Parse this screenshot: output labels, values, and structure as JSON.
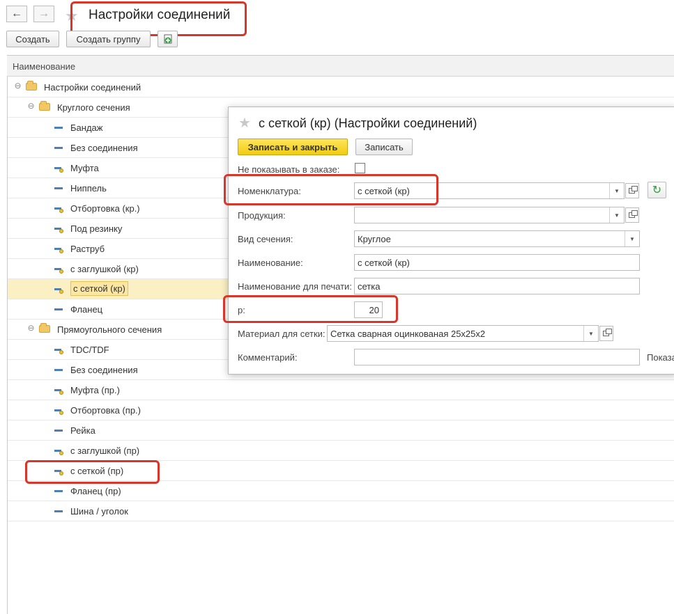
{
  "window": {
    "title": "Настройки соединений",
    "nav": {
      "back_icon": "←",
      "forward_icon": "→",
      "star_icon": "★"
    }
  },
  "toolbar": {
    "create_label": "Создать",
    "create_group_label": "Создать группу",
    "copy_icon": "add-copy-icon"
  },
  "list": {
    "column_header": "Наименование",
    "rows": [
      {
        "label": "Настройки соединений",
        "type": "group",
        "level": 0
      },
      {
        "label": "Круглого сечения",
        "type": "group",
        "level": 1
      },
      {
        "label": "Бандаж",
        "type": "item",
        "level": 2
      },
      {
        "label": "Без соединения",
        "type": "item",
        "level": 2
      },
      {
        "label": "Муфта",
        "type": "item-marked",
        "level": 2
      },
      {
        "label": "Ниппель",
        "type": "item",
        "level": 2
      },
      {
        "label": "Отбортовка (кр.)",
        "type": "item-marked",
        "level": 2
      },
      {
        "label": "Под резинку",
        "type": "item-marked",
        "level": 2
      },
      {
        "label": "Раструб",
        "type": "item-marked",
        "level": 2
      },
      {
        "label": "с заглушкой (кр)",
        "type": "item-marked",
        "level": 2
      },
      {
        "label": "с сеткой (кр)",
        "type": "item-marked",
        "level": 2,
        "selected": true
      },
      {
        "label": "Фланец",
        "type": "item",
        "level": 2
      },
      {
        "label": "Прямоугольного сечения",
        "type": "group",
        "level": 1
      },
      {
        "label": "TDC/TDF",
        "type": "item-marked",
        "level": 2
      },
      {
        "label": "Без соединения",
        "type": "item",
        "level": 2
      },
      {
        "label": "Муфта (пр.)",
        "type": "item-marked",
        "level": 2
      },
      {
        "label": "Отбортовка (пр.)",
        "type": "item-marked",
        "level": 2
      },
      {
        "label": "Рейка",
        "type": "item",
        "level": 2
      },
      {
        "label": "с заглушкой (пр)",
        "type": "item-marked",
        "level": 2
      },
      {
        "label": "с сеткой (пр)",
        "type": "item-marked",
        "level": 2
      },
      {
        "label": "Фланец (пр)",
        "type": "item",
        "level": 2
      },
      {
        "label": "Шина / уголок",
        "type": "item",
        "level": 2
      }
    ]
  },
  "dialog": {
    "title": "с сеткой (кр) (Настройки соединений)",
    "save_close_label": "Записать и закрыть",
    "save_label": "Записать",
    "fields": {
      "hide_in_order_label": "Не показывать в заказе:",
      "hide_in_order_checked": false,
      "nomenclature_label": "Номенклатура:",
      "nomenclature_value": "с сеткой (кр)",
      "product_label": "Продукция:",
      "product_value": "",
      "section_label": "Вид сечения:",
      "section_value": "Круглое",
      "name_label": "Наименование:",
      "name_value": "с сеткой (кр)",
      "print_name_label": "Наименование для печати:",
      "print_name_value": "сетка",
      "p_label": "p:",
      "p_value": "20",
      "mesh_label": "Материал для сетки:",
      "mesh_value": "Сетка сварная оцинкованая 25х25х2",
      "comment_label": "Комментарий:",
      "comment_value": "",
      "show_label": "Показа"
    }
  },
  "colors": {
    "highlight_red": "#d9362b",
    "primary_yellow": "#f5d31c",
    "selection": "#fbf0c4"
  }
}
